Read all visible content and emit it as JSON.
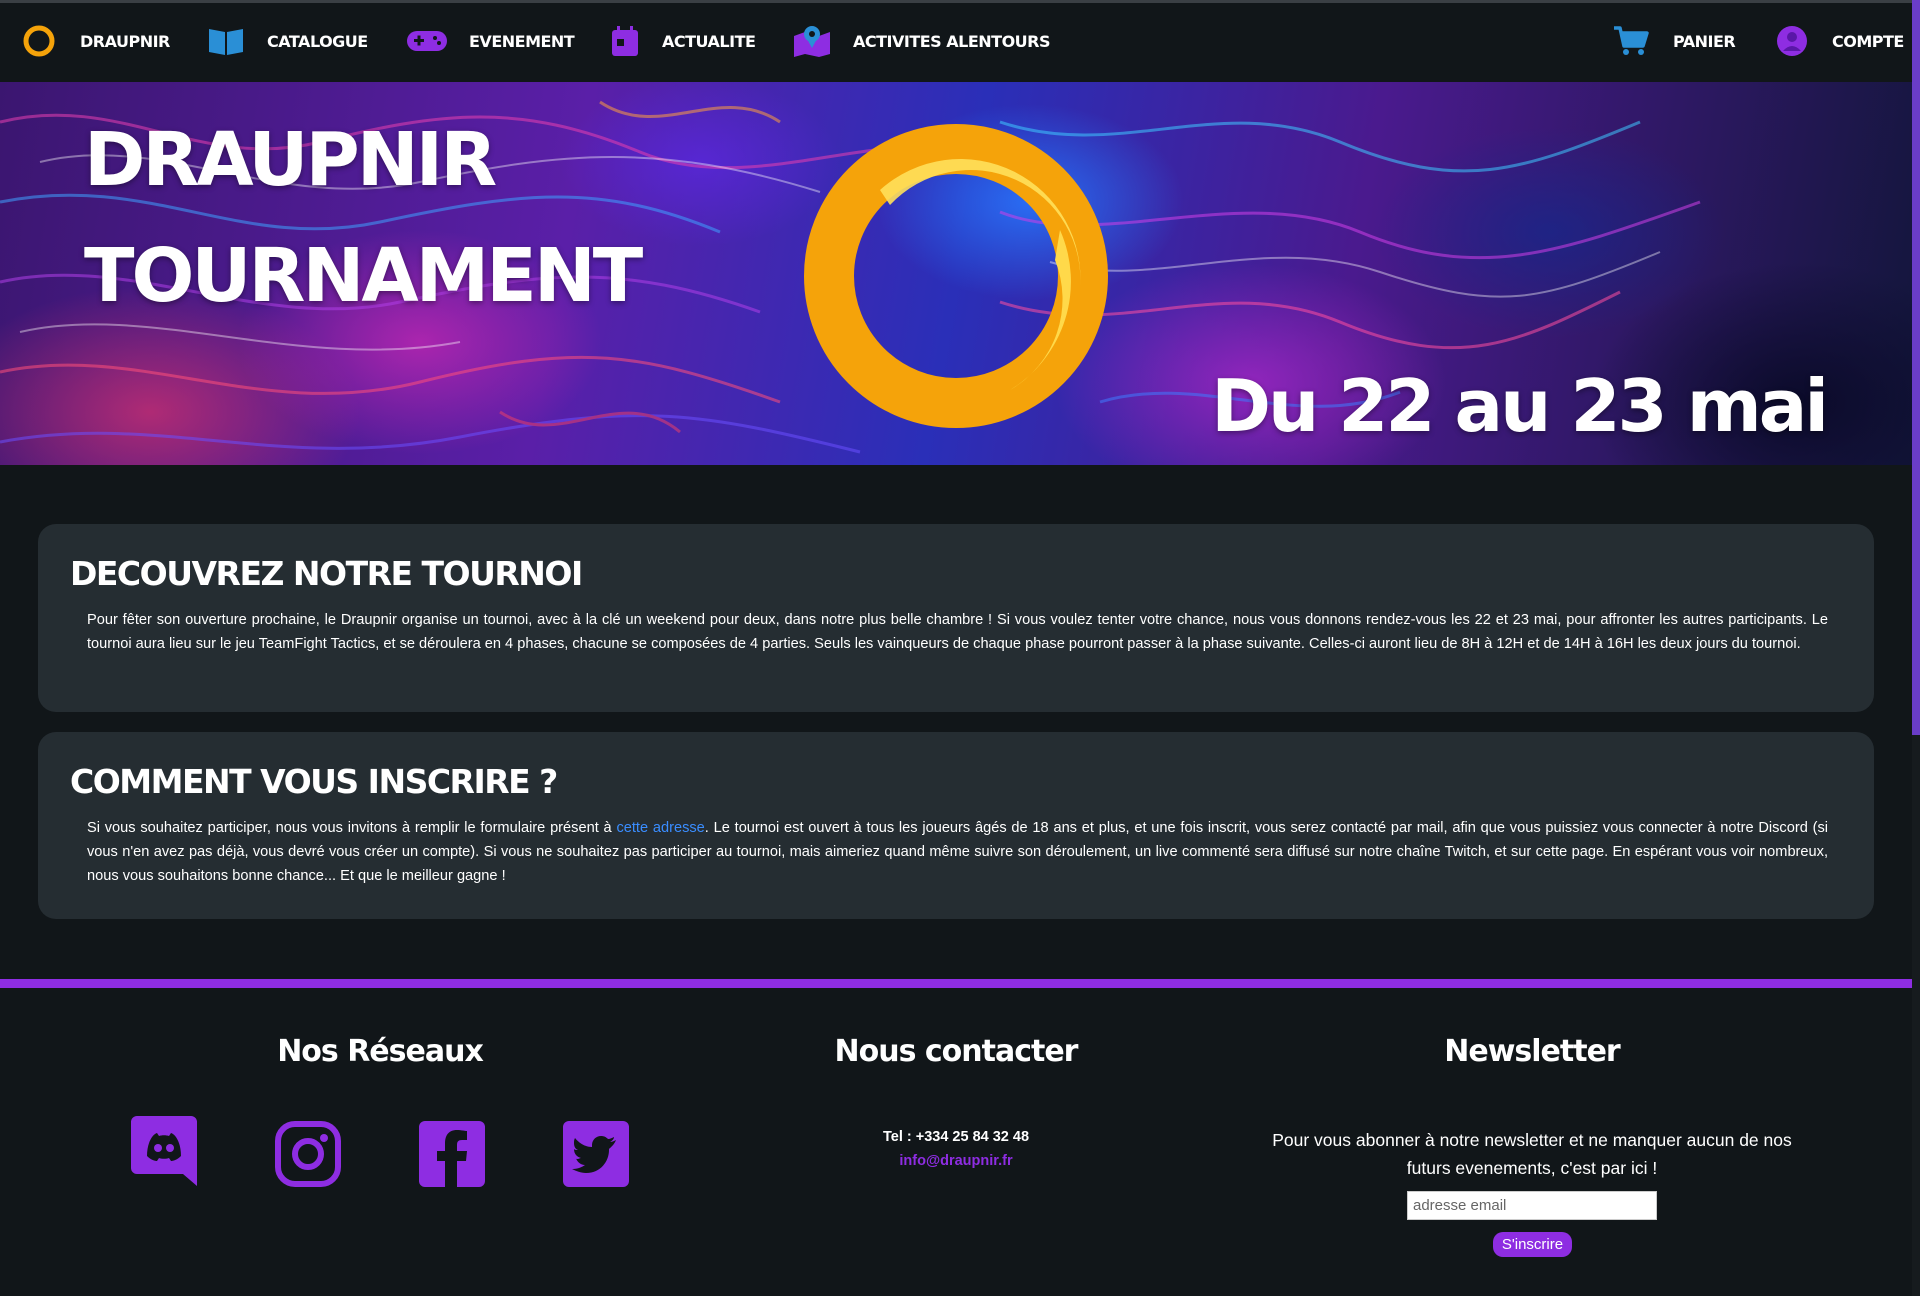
{
  "nav": {
    "brand": "DRAUPNIR",
    "catalogue": "CATALOGUE",
    "evenement": "EVENEMENT",
    "actualite": "ACTUALITE",
    "activites": "ACTIVITES ALENTOURS",
    "panier": "PANIER",
    "compte": "COMPTE"
  },
  "hero": {
    "title_line1": "DRAUPNIR",
    "title_line2": "TOURNAMENT",
    "date": "Du 22 au 23 mai"
  },
  "section1": {
    "title": "DECOUVREZ NOTRE TOURNOI",
    "text": "Pour fêter son ouverture prochaine, le Draupnir organise un tournoi, avec à la clé un weekend pour deux, dans notre plus belle chambre ! Si vous voulez tenter votre chance, nous vous donnons rendez-vous les 22 et 23 mai, pour affronter les autres participants. Le tournoi aura lieu sur le jeu TeamFight Tactics, et se déroulera en 4 phases, chacune se composées de 4 parties. Seuls les vainqueurs de chaque phase pourront passer à la phase suivante. Celles-ci auront lieu de 8H à 12H et de 14H à 16H les deux jours du tournoi."
  },
  "section2": {
    "title": "COMMENT VOUS INSCRIRE ?",
    "text_before": "Si vous souhaitez participer, nous vous invitons à remplir le formulaire présent à ",
    "link": "cette adresse",
    "text_after": ". Le tournoi est ouvert à tous les joueurs âgés de 18 ans et plus, et une fois inscrit, vous serez contacté par mail, afin que vous puissiez vous connecter à notre Discord (si vous n'en avez pas déjà, vous devré vous créer un compte). Si vous ne souhaitez pas participer au tournoi, mais aimeriez quand même suivre son déroulement, un live commenté sera diffusé sur notre chaîne Twitch, et sur cette page. En espérant vous voir nombreux, nous vous souhaitons bonne chance... Et que le meilleur gagne !"
  },
  "footer": {
    "reseaux_title": "Nos Réseaux",
    "contact_title": "Nous contacter",
    "newsletter_title": "Newsletter",
    "tel": "Tel : +334 25 84 32 48",
    "email": "info@draupnir.fr",
    "newsletter_text": "Pour vous abonner à notre newsletter et ne manquer aucun de nos futurs evenements, c'est par ici !",
    "email_placeholder": "adresse email",
    "subscribe": "S'inscrire",
    "socials": [
      "discord-icon",
      "instagram-icon",
      "facebook-icon",
      "twitter-icon"
    ]
  },
  "colors": {
    "accent": "#8e2de2",
    "ring": "#f5a30a",
    "card": "#252d32",
    "background": "#111619",
    "link": "#3a8dff"
  }
}
